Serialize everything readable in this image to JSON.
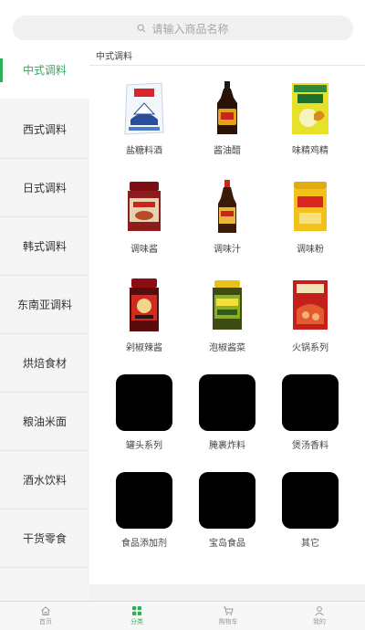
{
  "search": {
    "placeholder": "请输入商品名称",
    "icon": "search-icon"
  },
  "sidebar": {
    "active_color": "#2fae5a",
    "items": [
      {
        "label": "中式调料",
        "active": true
      },
      {
        "label": "西式调料"
      },
      {
        "label": "日式调料"
      },
      {
        "label": "韩式调料"
      },
      {
        "label": "东南亚调料"
      },
      {
        "label": "烘焙食材"
      },
      {
        "label": "粮油米面"
      },
      {
        "label": "酒水饮料"
      },
      {
        "label": "干货零食"
      }
    ]
  },
  "content": {
    "section_title": "中式调料",
    "items": [
      {
        "label": "盐糖料酒",
        "image": "salt-bag"
      },
      {
        "label": "酱油醋",
        "image": "soy-sauce-bottle"
      },
      {
        "label": "味精鸡精",
        "image": "msg-bag"
      },
      {
        "label": "调味酱",
        "image": "sauce-jar"
      },
      {
        "label": "调味汁",
        "image": "oyster-sauce-bottle"
      },
      {
        "label": "调味粉",
        "image": "powder-tub"
      },
      {
        "label": "剁椒辣酱",
        "image": "chili-sauce-jar"
      },
      {
        "label": "泡椒酱菜",
        "image": "pickle-jar"
      },
      {
        "label": "火锅系列",
        "image": "hotpot-pack"
      },
      {
        "label": "罐头系列",
        "image": "black-placeholder"
      },
      {
        "label": "腌裹炸料",
        "image": "black-placeholder"
      },
      {
        "label": "煲汤香料",
        "image": "black-placeholder"
      },
      {
        "label": "食品添加剂",
        "image": "black-placeholder"
      },
      {
        "label": "宝岛食品",
        "image": "black-placeholder"
      },
      {
        "label": "其它",
        "image": "black-placeholder"
      }
    ]
  },
  "bottom_nav": {
    "items": [
      {
        "label": "首页",
        "icon": "home-icon"
      },
      {
        "label": "分类",
        "icon": "category-icon",
        "active": true
      },
      {
        "label": "购物车",
        "icon": "cart-icon"
      },
      {
        "label": "我的",
        "icon": "user-icon"
      }
    ]
  }
}
